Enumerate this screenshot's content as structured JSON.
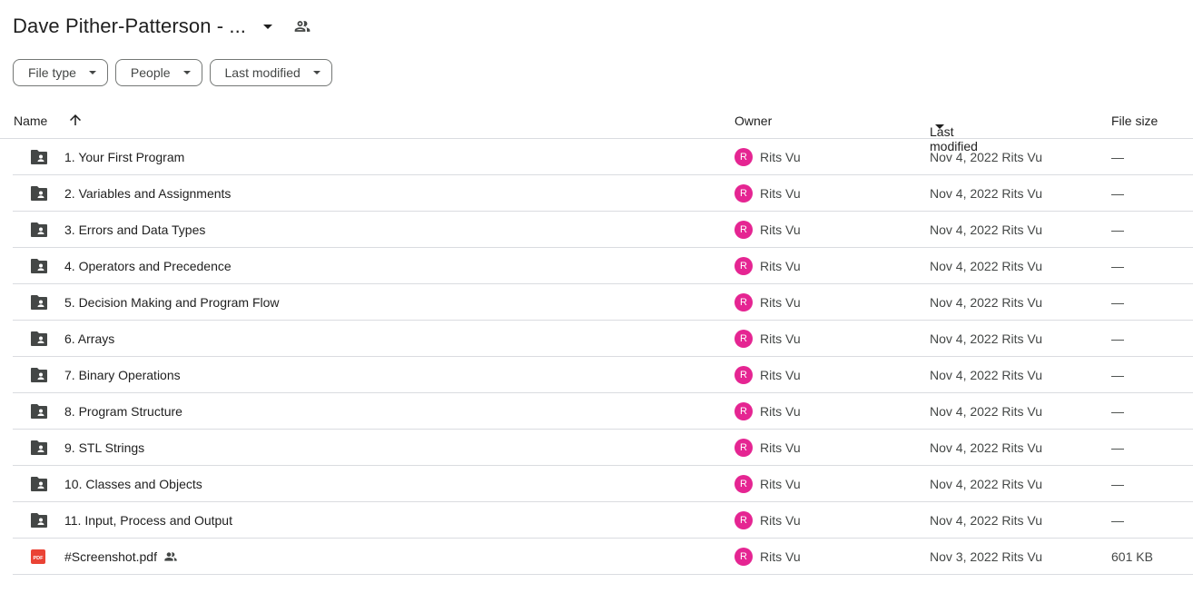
{
  "header": {
    "title": "Dave Pither-Patterson - ...",
    "caret_icon": "arrow-drop-down-icon",
    "shared_icon": "people-icon"
  },
  "filters": [
    {
      "label": "File type"
    },
    {
      "label": "People"
    },
    {
      "label": "Last modified"
    }
  ],
  "columns": {
    "name": "Name",
    "owner": "Owner",
    "last_modified": "Last modified",
    "file_size": "File size"
  },
  "rows": [
    {
      "type": "shared-folder",
      "name": "1. Your First Program",
      "avatar": "R",
      "owner": "Rits Vu",
      "modified": "Nov 4, 2022 Rits Vu",
      "size": "—"
    },
    {
      "type": "shared-folder",
      "name": "2. Variables and Assignments",
      "avatar": "R",
      "owner": "Rits Vu",
      "modified": "Nov 4, 2022 Rits Vu",
      "size": "—"
    },
    {
      "type": "shared-folder",
      "name": "3. Errors and Data Types",
      "avatar": "R",
      "owner": "Rits Vu",
      "modified": "Nov 4, 2022 Rits Vu",
      "size": "—"
    },
    {
      "type": "shared-folder",
      "name": "4. Operators and Precedence",
      "avatar": "R",
      "owner": "Rits Vu",
      "modified": "Nov 4, 2022 Rits Vu",
      "size": "—"
    },
    {
      "type": "shared-folder",
      "name": "5. Decision Making and Program Flow",
      "avatar": "R",
      "owner": "Rits Vu",
      "modified": "Nov 4, 2022 Rits Vu",
      "size": "—"
    },
    {
      "type": "shared-folder",
      "name": "6. Arrays",
      "avatar": "R",
      "owner": "Rits Vu",
      "modified": "Nov 4, 2022 Rits Vu",
      "size": "—"
    },
    {
      "type": "shared-folder",
      "name": "7. Binary Operations",
      "avatar": "R",
      "owner": "Rits Vu",
      "modified": "Nov 4, 2022 Rits Vu",
      "size": "—"
    },
    {
      "type": "shared-folder",
      "name": "8. Program Structure",
      "avatar": "R",
      "owner": "Rits Vu",
      "modified": "Nov 4, 2022 Rits Vu",
      "size": "—"
    },
    {
      "type": "shared-folder",
      "name": "9. STL Strings",
      "avatar": "R",
      "owner": "Rits Vu",
      "modified": "Nov 4, 2022 Rits Vu",
      "size": "—"
    },
    {
      "type": "shared-folder",
      "name": "10. Classes and Objects",
      "avatar": "R",
      "owner": "Rits Vu",
      "modified": "Nov 4, 2022 Rits Vu",
      "size": "—"
    },
    {
      "type": "shared-folder",
      "name": "11. Input, Process and Output",
      "avatar": "R",
      "owner": "Rits Vu",
      "modified": "Nov 4, 2022 Rits Vu",
      "size": "—"
    },
    {
      "type": "pdf",
      "pdf_label": "PDF",
      "name": "#Screenshot.pdf",
      "shared": true,
      "avatar": "R",
      "owner": "Rits Vu",
      "modified": "Nov 3, 2022 Rits Vu",
      "size": "601 KB"
    }
  ],
  "colors": {
    "avatar": "#e52592",
    "pdf": "#ea4335",
    "folder": "#444746"
  }
}
